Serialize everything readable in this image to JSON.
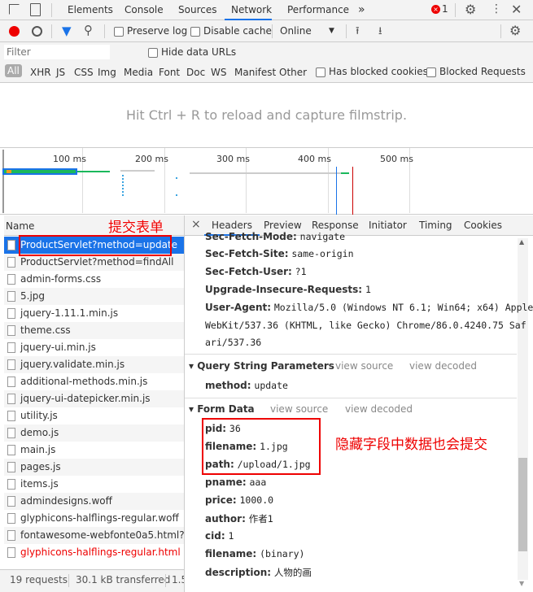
{
  "toolbar": {
    "tabs": [
      "Elements",
      "Console",
      "Sources",
      "Network",
      "Performance"
    ],
    "active": "Network",
    "more": "»",
    "error_count": "1"
  },
  "network_toolbar": {
    "preserve_log": "Preserve log",
    "disable_cache": "Disable cache",
    "throttle": "Online"
  },
  "filter": {
    "placeholder": "Filter",
    "hide_data_urls": "Hide data URLs"
  },
  "types": [
    "All",
    "XHR",
    "JS",
    "CSS",
    "Img",
    "Media",
    "Font",
    "Doc",
    "WS",
    "Manifest",
    "Other"
  ],
  "blocked_cookies": "Has blocked cookies",
  "blocked_requests": "Blocked Requests",
  "filmstrip_msg": "Hit Ctrl + R to reload and capture filmstrip.",
  "overview_ticks": [
    "100 ms",
    "200 ms",
    "300 ms",
    "400 ms",
    "500 ms"
  ],
  "name_header": "Name",
  "requests": [
    {
      "name": "ProductServlet?method=update",
      "selected": true
    },
    {
      "name": "ProductServlet?method=findAll"
    },
    {
      "name": "admin-forms.css"
    },
    {
      "name": "5.jpg",
      "icon": "image"
    },
    {
      "name": "jquery-1.11.1.min.js"
    },
    {
      "name": "theme.css"
    },
    {
      "name": "jquery-ui.min.js"
    },
    {
      "name": "jquery.validate.min.js"
    },
    {
      "name": "additional-methods.min.js"
    },
    {
      "name": "jquery-ui-datepicker.min.js"
    },
    {
      "name": "utility.js"
    },
    {
      "name": "demo.js"
    },
    {
      "name": "main.js"
    },
    {
      "name": "pages.js"
    },
    {
      "name": "items.js"
    },
    {
      "name": "admindesigns.woff"
    },
    {
      "name": "glyphicons-halflings-regular.woff"
    },
    {
      "name": "fontawesome-webfonte0a5.html?v..."
    },
    {
      "name": "glyphicons-halflings-regular.html",
      "error": true
    }
  ],
  "footer": {
    "requests": "19 requests",
    "transferred": "30.1 kB transferred",
    "resources": "1.5"
  },
  "detail_tabs": [
    "Headers",
    "Preview",
    "Response",
    "Initiator",
    "Timing",
    "Cookies"
  ],
  "headers": [
    {
      "k": "Sec-Fetch-Mode:",
      "v": "navigate"
    },
    {
      "k": "Sec-Fetch-Site:",
      "v": "same-origin"
    },
    {
      "k": "Sec-Fetch-User:",
      "v": "?1"
    },
    {
      "k": "Upgrade-Insecure-Requests:",
      "v": "1"
    },
    {
      "k": "User-Agent:",
      "v": "Mozilla/5.0 (Windows NT 6.1; Win64; x64) Apple"
    }
  ],
  "ua_cont": [
    "WebKit/537.36 (KHTML, like Gecko) Chrome/86.0.4240.75 Saf",
    "ari/537.36"
  ],
  "query": {
    "title": "Query String Parameters",
    "view_source": "view source",
    "view_decoded": "view decoded",
    "params": [
      {
        "k": "method:",
        "v": "update"
      }
    ]
  },
  "form": {
    "title": "Form Data",
    "view_source": "view source",
    "view_decoded": "view decoded",
    "params": [
      {
        "k": "pid:",
        "v": "36"
      },
      {
        "k": "filename:",
        "v": "1.jpg"
      },
      {
        "k": "path:",
        "v": "/upload/1.jpg"
      },
      {
        "k": "pname:",
        "v": "aaa"
      },
      {
        "k": "price:",
        "v": "1000.0"
      },
      {
        "k": "author:",
        "v": "作者1"
      },
      {
        "k": "cid:",
        "v": "1"
      },
      {
        "k": "filename:",
        "v": "(binary)"
      },
      {
        "k": "description:",
        "v": "人物的画"
      }
    ]
  },
  "annotations": {
    "submit": "提交表单",
    "hidden": "隐藏字段中数据也会提交"
  },
  "colors": {
    "accent": "#1a73e8",
    "record": "#e00",
    "annotation": "#ff0000",
    "selected_row": "#1a73e8"
  }
}
